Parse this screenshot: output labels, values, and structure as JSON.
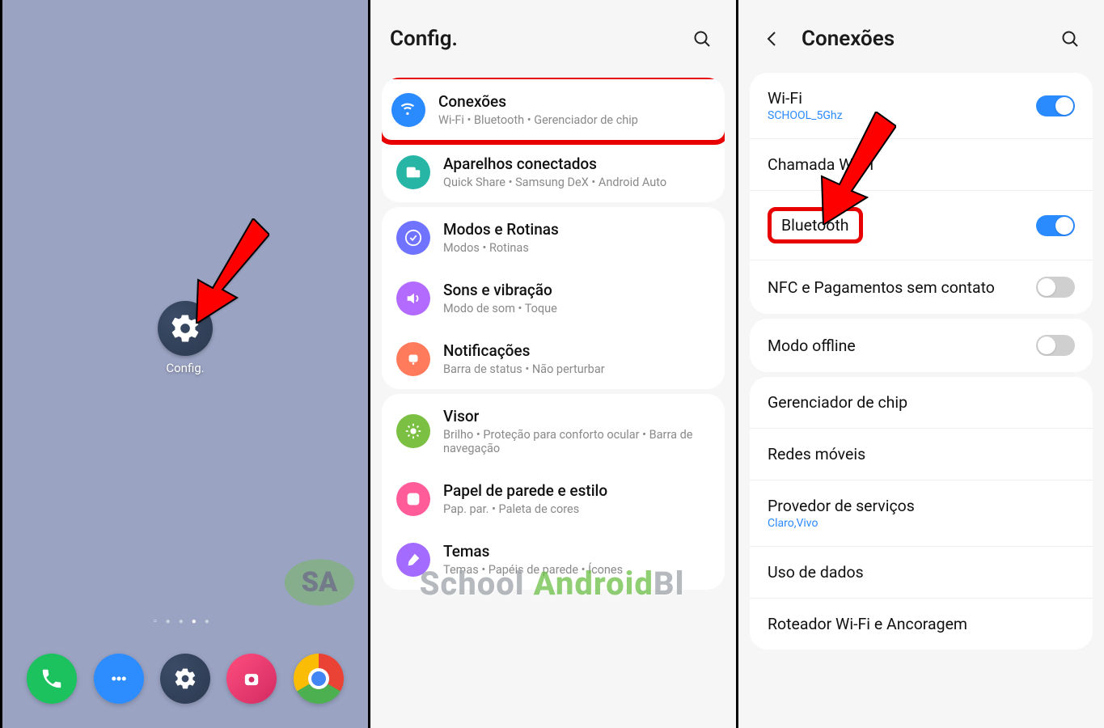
{
  "panel1": {
    "app_label": "Config."
  },
  "panel2": {
    "title": "Config.",
    "groups": [
      [
        {
          "title": "Conexões",
          "sub": "Wi-Fi  •  Bluetooth  •  Gerenciador de chip",
          "color": "#2a8aff",
          "icon": "wifi",
          "highlight": true
        },
        {
          "title": "Aparelhos conectados",
          "sub": "Quick Share  •  Samsung DeX  •  Android Auto",
          "color": "#27b6a6",
          "icon": "devices"
        }
      ],
      [
        {
          "title": "Modos e Rotinas",
          "sub": "Modos  •  Rotinas",
          "color": "#6f73ff",
          "icon": "check"
        },
        {
          "title": "Sons e vibração",
          "sub": "Modo de som  •  Toque",
          "color": "#b36bff",
          "icon": "sound"
        },
        {
          "title": "Notificações",
          "sub": "Barra de status  •  Não perturbar",
          "color": "#ff7b5c",
          "icon": "bell"
        }
      ],
      [
        {
          "title": "Visor",
          "sub": "Brilho  •  Proteção para conforto ocular  •  Barra de navegação",
          "color": "#7bc043",
          "icon": "sun"
        },
        {
          "title": "Papel de parede e estilo",
          "sub": "Pap. par.  •  Paleta de cores",
          "color": "#ff5c99",
          "icon": "palette"
        },
        {
          "title": "Temas",
          "sub": "Temas  •  Papéis de parede  •  Ícones",
          "color": "#a36bff",
          "icon": "brush"
        }
      ]
    ]
  },
  "panel3": {
    "title": "Conexões",
    "groups": [
      [
        {
          "title": "Wi-Fi",
          "sub": "SCHOOL_5Ghz",
          "sub_style": "blue",
          "toggle": "on"
        },
        {
          "title": "Chamada Wi-Fi"
        },
        {
          "title": "Bluetooth",
          "toggle": "on",
          "boxed": true
        },
        {
          "title": "NFC e Pagamentos sem contato",
          "toggle": "off"
        }
      ],
      [
        {
          "title": "Modo offline",
          "toggle": "off"
        }
      ],
      [
        {
          "title": "Gerenciador de chip"
        },
        {
          "title": "Redes móveis"
        },
        {
          "title": "Provedor de serviços",
          "sub": "Claro,Vivo",
          "sub_style": "blue"
        },
        {
          "title": "Uso de dados"
        },
        {
          "title": "Roteador Wi-Fi e Ancoragem"
        }
      ]
    ]
  },
  "watermark": {
    "a": "School ",
    "b": "Android",
    "c": "Bl"
  }
}
